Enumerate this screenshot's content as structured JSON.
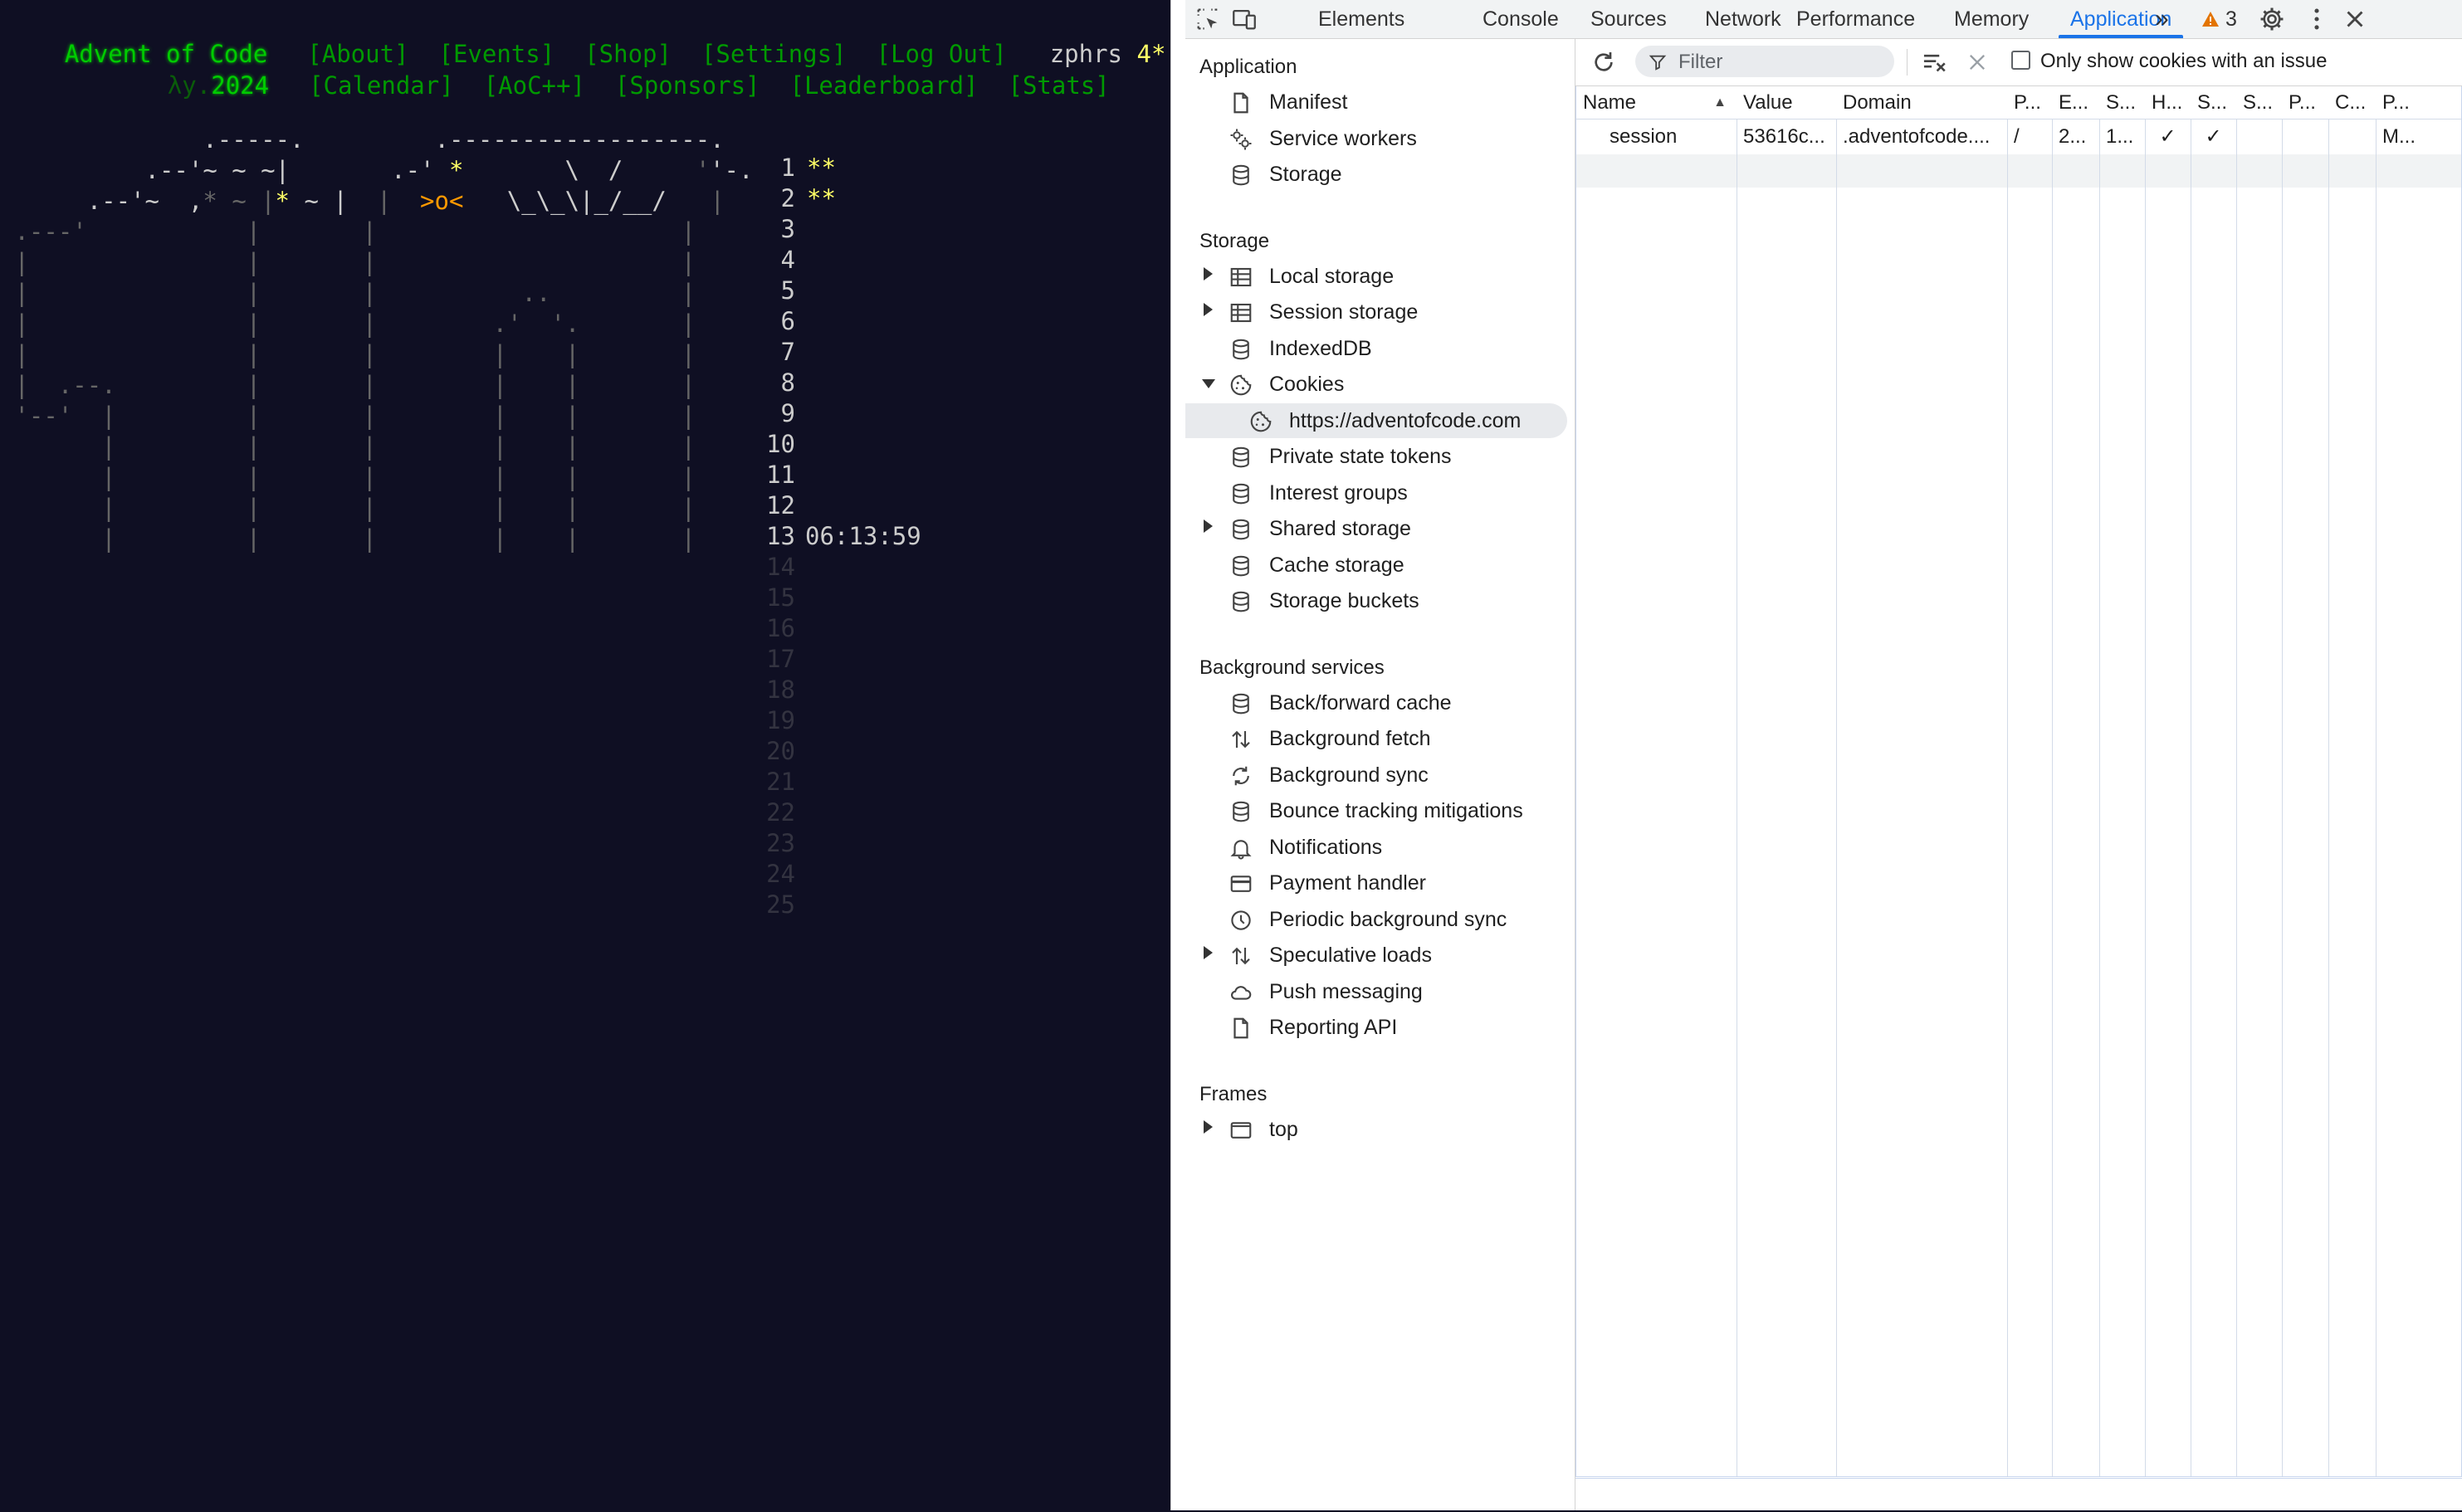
{
  "aoc": {
    "title": "Advent of Code",
    "subtitle_prefix": "λy.",
    "subtitle_year": "2024",
    "nav_row1": [
      "[About]",
      "[Events]",
      "[Shop]",
      "[Settings]",
      "[Log Out]"
    ],
    "nav_row2": [
      "[Calendar]",
      "[AoC++]",
      "[Sponsors]",
      "[Leaderboard]",
      "[Stats]"
    ],
    "user": "zphrs",
    "user_stars": "4*",
    "days": [
      {
        "n": "1",
        "stars": "**"
      },
      {
        "n": "2",
        "stars": "**"
      },
      {
        "n": "3"
      },
      {
        "n": "4"
      },
      {
        "n": "5"
      },
      {
        "n": "6"
      },
      {
        "n": "7"
      },
      {
        "n": "8"
      },
      {
        "n": "9"
      },
      {
        "n": "10"
      },
      {
        "n": "11"
      },
      {
        "n": "12"
      },
      {
        "n": "13",
        "countdown": "06:13:59"
      },
      {
        "n": "14"
      },
      {
        "n": "15"
      },
      {
        "n": "16"
      },
      {
        "n": "17"
      },
      {
        "n": "18"
      },
      {
        "n": "19"
      },
      {
        "n": "20"
      },
      {
        "n": "21"
      },
      {
        "n": "22"
      },
      {
        "n": "23"
      },
      {
        "n": "24"
      },
      {
        "n": "25"
      }
    ],
    "art": [
      "              .-----.         .------------------.",
      "          .--'~ ~ ~|       .-' *       \\  /     '-.",
      "      .--'~  ,* ~ |       |  >o<   \\_\\_\\|_/__/   |",
      " .---'           |       |                     |",
      " |               |       |                     |",
      " |               |       |          ..         |",
      " |               |       |        .'  '.       |",
      " |               |       |        |    |       |",
      " |  .--.         |       |        |    |       |",
      " '--'  |         |       |        |    |       |",
      "       |         |       |        |    |       |",
      "       |         |       |        |    |       |",
      "       |         |       |        |    |       |",
      "       |         |       |        |    |       |"
    ]
  },
  "devtools": {
    "tabs": [
      "Elements",
      "Console",
      "Sources",
      "Network",
      "Performance",
      "Memory",
      "Application"
    ],
    "active_tab": "Application",
    "more_tabs": "»",
    "warning_count": "3",
    "sidebar": {
      "sections": [
        {
          "title": "Application",
          "items": [
            {
              "label": "Manifest",
              "icon": "file-icon"
            },
            {
              "label": "Service workers",
              "icon": "gears-icon"
            },
            {
              "label": "Storage",
              "icon": "database-icon"
            }
          ]
        },
        {
          "title": "Storage",
          "items": [
            {
              "label": "Local storage",
              "icon": "table-icon",
              "expander": "right"
            },
            {
              "label": "Session storage",
              "icon": "table-icon",
              "expander": "right"
            },
            {
              "label": "IndexedDB",
              "icon": "database-icon"
            },
            {
              "label": "Cookies",
              "icon": "cookie-icon",
              "expander": "down"
            },
            {
              "label": "https://adventofcode.com",
              "icon": "cookie-icon",
              "sub": true,
              "selected": true
            },
            {
              "label": "Private state tokens",
              "icon": "database-icon"
            },
            {
              "label": "Interest groups",
              "icon": "database-icon"
            },
            {
              "label": "Shared storage",
              "icon": "database-icon",
              "expander": "right"
            },
            {
              "label": "Cache storage",
              "icon": "database-icon"
            },
            {
              "label": "Storage buckets",
              "icon": "database-icon"
            }
          ]
        },
        {
          "title": "Background services",
          "items": [
            {
              "label": "Back/forward cache",
              "icon": "database-icon"
            },
            {
              "label": "Background fetch",
              "icon": "updown-arrows-icon"
            },
            {
              "label": "Background sync",
              "icon": "sync-icon"
            },
            {
              "label": "Bounce tracking mitigations",
              "icon": "database-icon"
            },
            {
              "label": "Notifications",
              "icon": "bell-icon"
            },
            {
              "label": "Payment handler",
              "icon": "card-icon"
            },
            {
              "label": "Periodic background sync",
              "icon": "clock-icon"
            },
            {
              "label": "Speculative loads",
              "icon": "updown-arrows-icon",
              "expander": "right"
            },
            {
              "label": "Push messaging",
              "icon": "cloud-icon"
            },
            {
              "label": "Reporting API",
              "icon": "file-icon"
            }
          ]
        },
        {
          "title": "Frames",
          "items": [
            {
              "label": "top",
              "icon": "frame-icon",
              "expander": "right"
            }
          ]
        }
      ]
    },
    "cookies": {
      "filter_placeholder": "Filter",
      "only_issue_label": "Only show cookies with an issue",
      "sort_indicator": "▲",
      "columns": [
        "Name",
        "Value",
        "Domain",
        "P...",
        "E...",
        "S...",
        "H...",
        "S...",
        "S...",
        "P...",
        "C...",
        "P..."
      ],
      "rows": [
        [
          "session",
          "53616c...",
          ".adventofcode....",
          "/",
          "2...",
          "1...",
          "✓",
          "✓",
          "",
          "",
          "",
          "M..."
        ]
      ]
    }
  }
}
